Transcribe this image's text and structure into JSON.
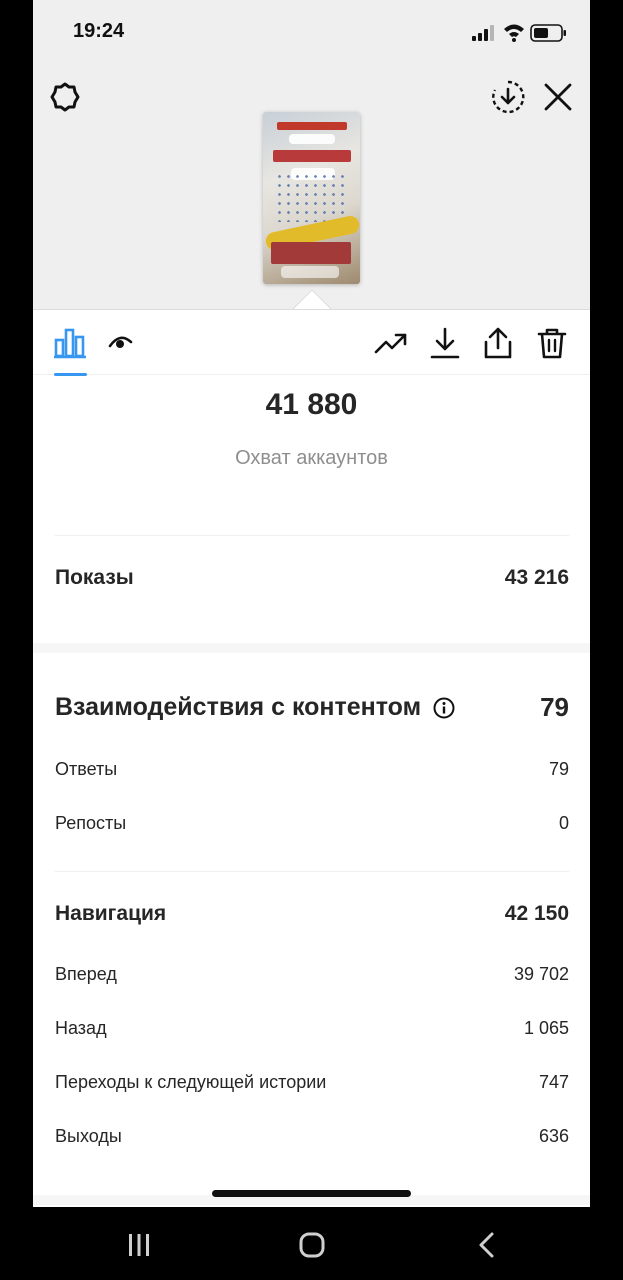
{
  "status_bar": {
    "time": "19:24"
  },
  "header": {
    "settings_icon": "gear-icon",
    "download_icon": "download-circle-icon",
    "close_icon": "close-icon"
  },
  "toolbar": {
    "tabs": [
      {
        "icon": "bar-chart-icon",
        "active": true
      },
      {
        "icon": "eye-icon",
        "active": false
      }
    ],
    "actions": [
      "trending-icon",
      "download-icon",
      "share-icon",
      "trash-icon"
    ],
    "accent_color": "#3797f0"
  },
  "reach": {
    "value": "41 880",
    "label": "Охват аккаунтов"
  },
  "impressions": {
    "label": "Показы",
    "value": "43 216"
  },
  "interactions": {
    "label": "Взаимодействия с контентом",
    "value": "79",
    "items": [
      {
        "label": "Ответы",
        "value": "79"
      },
      {
        "label": "Репосты",
        "value": "0"
      }
    ]
  },
  "navigation": {
    "label": "Навигация",
    "value": "42 150",
    "items": [
      {
        "label": "Вперед",
        "value": "39 702"
      },
      {
        "label": "Назад",
        "value": "1 065"
      },
      {
        "label": "Переходы к следующей истории",
        "value": "747"
      },
      {
        "label": "Выходы",
        "value": "636"
      }
    ]
  },
  "android_nav": [
    "recents-icon",
    "home-icon",
    "back-icon"
  ]
}
